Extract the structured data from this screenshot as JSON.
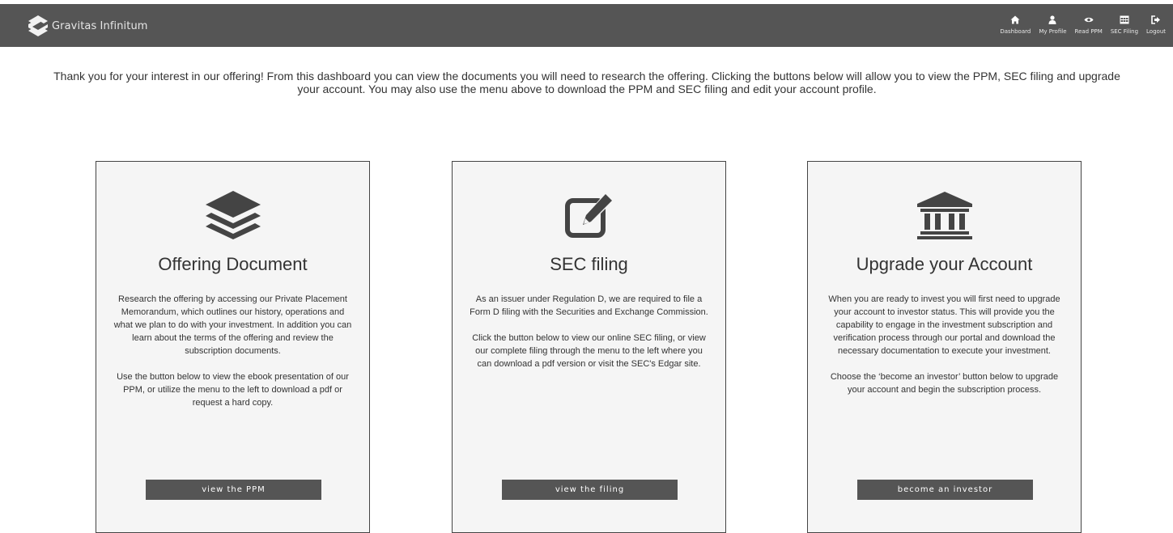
{
  "brand": {
    "name": "Gravitas Infinitum"
  },
  "nav": [
    {
      "label": "Dashboard",
      "icon": "home-icon"
    },
    {
      "label": "My Profile",
      "icon": "user-icon"
    },
    {
      "label": "Read PPM",
      "icon": "eye-icon"
    },
    {
      "label": "SEC Filing",
      "icon": "table-icon"
    },
    {
      "label": "Logout",
      "icon": "sign-out-icon"
    }
  ],
  "intro": {
    "text": "Thank you for your interest in our offering! From this dashboard you can view the documents you will need to research the offering. Clicking the buttons below will allow you to view the PPM, SEC filing and upgrade your account. You may also use the menu above to download the PPM and SEC filing and edit your account profile."
  },
  "cards": [
    {
      "icon": "layers-icon",
      "title": "Offering Document",
      "paragraphs": [
        "Research the offering by accessing our Private Placement Memorandum, which outlines our history, operations and what we plan to do with your investment. In addition you can learn about the terms of the offering and review the subscription documents.",
        "Use the button below to view the ebook presentation of our PPM, or utilize the menu to the left to download a pdf or request a hard copy."
      ],
      "button": "view the PPM"
    },
    {
      "icon": "edit-icon",
      "title": "SEC filing",
      "paragraphs": [
        "As an issuer under Regulation D, we are required to file a Form D filing with the Securities and Exchange Commission.",
        "Click the button below to view our online SEC filing, or view our complete filing through the menu to the left where you can download a pdf version or visit the SEC's Edgar site."
      ],
      "button": "view the filing"
    },
    {
      "icon": "bank-icon",
      "title": "Upgrade your Account",
      "paragraphs": [
        "When you are ready to invest you will first need to upgrade your account to investor status. This will provide you the capability to engage in the investment subscription and verification process through our portal and download the necessary documentation to execute your investment.",
        "Choose the ‘become an investor’ button below to upgrade your account and begin the subscription process."
      ],
      "button": "become an investor"
    }
  ],
  "colors": {
    "topbar": "#555555",
    "card_bg": "#f5f5f5",
    "button_bg": "#555555",
    "text": "#333333"
  }
}
